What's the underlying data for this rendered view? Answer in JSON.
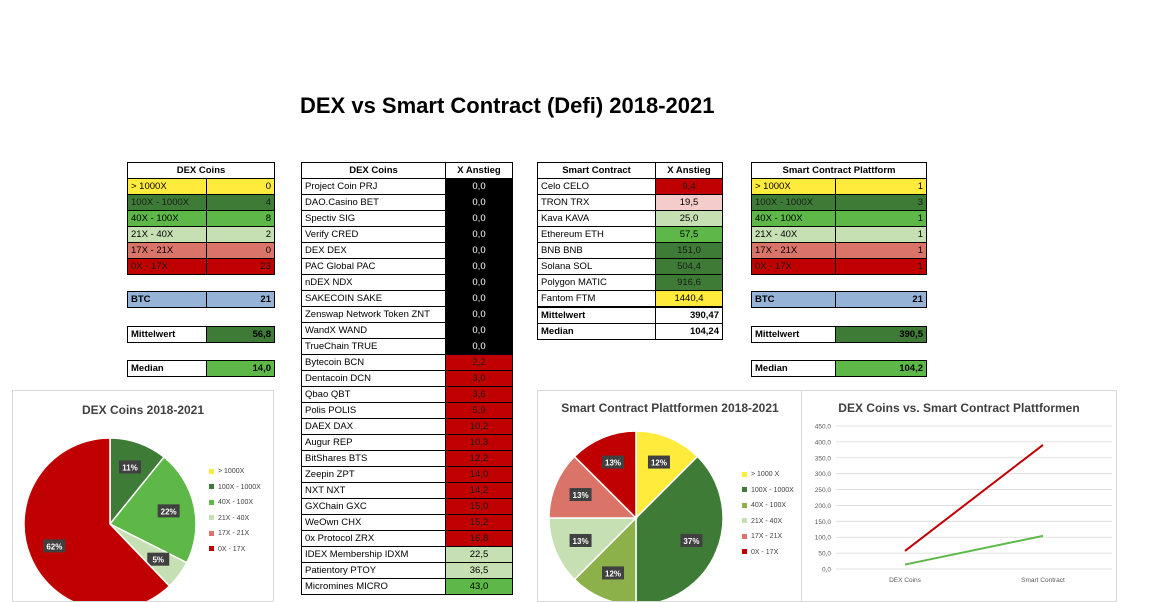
{
  "title": "DEX vs Smart Contract (Defi) 2018-2021",
  "colors": {
    "yellow": "#FFEB3B",
    "dark_green": "#3E7B36",
    "green": "#5DB847",
    "light_green": "#C6E0B4",
    "salmon": "#DA7468",
    "red": "#C00000",
    "pink": "#F4CCCC",
    "blue": "#95B3D7",
    "black": "#000000"
  },
  "dex_summary": {
    "header": "DEX Coins",
    "rows": [
      {
        "label": "> 1000X",
        "value": "0",
        "color": "#FFEB3B"
      },
      {
        "label": "100X - 1000X",
        "value": "4",
        "color": "#3E7B36"
      },
      {
        "label": "40X - 100X",
        "value": "8",
        "color": "#5DB847"
      },
      {
        "label": "21X - 40X",
        "value": "2",
        "color": "#C6E0B4"
      },
      {
        "label": "17X - 21X",
        "value": "0",
        "color": "#DA7468"
      },
      {
        "label": "0X - 17X",
        "value": "23",
        "color": "#C00000"
      }
    ],
    "btc_label": "BTC",
    "btc_value": "21",
    "mean_label": "Mittelwert",
    "mean_value": "56,8",
    "median_label": "Median",
    "median_value": "14,0"
  },
  "dex_list": {
    "col1": "DEX Coins",
    "col2": "X Anstieg",
    "rows": [
      {
        "name": "Project Coin PRJ",
        "value": "0,0",
        "color": "#000000"
      },
      {
        "name": "DAO.Casino BET",
        "value": "0,0",
        "color": "#000000"
      },
      {
        "name": "Spectiv SIG",
        "value": "0,0",
        "color": "#000000"
      },
      {
        "name": "Verify CRED",
        "value": "0,0",
        "color": "#000000"
      },
      {
        "name": "DEX DEX",
        "value": "0,0",
        "color": "#000000"
      },
      {
        "name": "PAC Global PAC",
        "value": "0,0",
        "color": "#000000"
      },
      {
        "name": "nDEX NDX",
        "value": "0,0",
        "color": "#000000"
      },
      {
        "name": "SAKECOIN SAKE",
        "value": "0,0",
        "color": "#000000"
      },
      {
        "name": "Zenswap Network Token ZNT",
        "value": "0,0",
        "color": "#000000"
      },
      {
        "name": "WandX WAND",
        "value": "0,0",
        "color": "#000000"
      },
      {
        "name": "TrueChain TRUE",
        "value": "0,0",
        "color": "#000000"
      },
      {
        "name": "Bytecoin BCN",
        "value": "2,2",
        "color": "#C00000"
      },
      {
        "name": "Dentacoin DCN",
        "value": "3,0",
        "color": "#C00000"
      },
      {
        "name": "Qbao QBT",
        "value": "3,6",
        "color": "#C00000"
      },
      {
        "name": "Polis POLIS",
        "value": "5,9",
        "color": "#C00000"
      },
      {
        "name": "DAEX DAX",
        "value": "10,2",
        "color": "#C00000"
      },
      {
        "name": "Augur REP",
        "value": "10,3",
        "color": "#C00000"
      },
      {
        "name": "BitShares BTS",
        "value": "12,2",
        "color": "#C00000"
      },
      {
        "name": "Zeepin ZPT",
        "value": "14,0",
        "color": "#C00000"
      },
      {
        "name": "NXT NXT",
        "value": "14,2",
        "color": "#C00000"
      },
      {
        "name": "GXChain GXC",
        "value": "15,0",
        "color": "#C00000"
      },
      {
        "name": "WeOwn CHX",
        "value": "15,2",
        "color": "#C00000"
      },
      {
        "name": "0x Protocol ZRX",
        "value": "16,8",
        "color": "#C00000"
      },
      {
        "name": "IDEX Membership IDXM",
        "value": "22,5",
        "color": "#C6E0B4"
      },
      {
        "name": "Patientory PTOY",
        "value": "36,5",
        "color": "#C6E0B4"
      },
      {
        "name": "Micromines MICRO",
        "value": "43,0",
        "color": "#5DB847"
      }
    ]
  },
  "sc_list": {
    "col1": "Smart Contract",
    "col2": "X Anstieg",
    "rows": [
      {
        "name": "Celo CELO",
        "value": "9,4",
        "color": "#C00000"
      },
      {
        "name": "TRON TRX",
        "value": "19,5",
        "color": "#F4CCCC"
      },
      {
        "name": "Kava KAVA",
        "value": "25,0",
        "color": "#C6E0B4"
      },
      {
        "name": "Ethereum ETH",
        "value": "57,5",
        "color": "#5DB847"
      },
      {
        "name": "BNB BNB",
        "value": "151,0",
        "color": "#3E7B36"
      },
      {
        "name": "Solana SOL",
        "value": "504,4",
        "color": "#3E7B36"
      },
      {
        "name": "Polygon MATIC",
        "value": "916,6",
        "color": "#3E7B36"
      },
      {
        "name": "Fantom FTM",
        "value": "1440,4",
        "color": "#FFEB3B"
      }
    ],
    "mean_label": "Mittelwert",
    "mean_value": "390,47",
    "median_label": "Median",
    "median_value": "104,24"
  },
  "sc_summary": {
    "header": "Smart Contract Plattform",
    "rows": [
      {
        "label": "> 1000X",
        "value": "1",
        "color": "#FFEB3B"
      },
      {
        "label": "100X - 1000X",
        "value": "3",
        "color": "#3E7B36"
      },
      {
        "label": "40X - 100X",
        "value": "1",
        "color": "#5DB847"
      },
      {
        "label": "21X - 40X",
        "value": "1",
        "color": "#C6E0B4"
      },
      {
        "label": "17X - 21X",
        "value": "1",
        "color": "#DA7468"
      },
      {
        "label": "0X - 17X",
        "value": "1",
        "color": "#C00000"
      }
    ],
    "btc_label": "BTC",
    "btc_value": "21",
    "mean_label": "Mittelwert",
    "mean_value": "390,5",
    "median_label": "Median",
    "median_value": "104,2"
  },
  "chart_data": [
    {
      "type": "pie",
      "title": "DEX Coins 2018-2021",
      "labels": [
        "> 1000X",
        "100X - 1000X",
        "40X - 100X",
        "21X - 40X",
        "17X - 21X",
        "0X - 17X"
      ],
      "values": [
        0,
        4,
        8,
        2,
        0,
        23
      ],
      "data_labels": [
        "",
        "11%",
        "22%",
        "5%",
        "",
        "62%"
      ],
      "colors": [
        "#FFEB3B",
        "#3E7B36",
        "#5DB847",
        "#C6E0B4",
        "#DA7468",
        "#C00000"
      ],
      "legend": "right"
    },
    {
      "type": "pie",
      "title": "Smart Contract Plattformen 2018-2021",
      "labels": [
        "> 1000 X",
        "100X - 1000X",
        "40X - 100X",
        "21X - 40X",
        "17X - 21X",
        "0X - 17X"
      ],
      "values": [
        1,
        3,
        1,
        1,
        1,
        1
      ],
      "data_labels": [
        "12%",
        "37%",
        "12%",
        "13%",
        "13%",
        "13%"
      ],
      "colors": [
        "#FFEB3B",
        "#3E7B36",
        "#8DB14A",
        "#C6E0B4",
        "#DA7468",
        "#C00000"
      ],
      "legend": "right"
    },
    {
      "type": "line",
      "title": "DEX Coins vs. Smart Contract Plattformen",
      "categories": [
        "DEX Coins",
        "Smart Contract"
      ],
      "series": [
        {
          "values": [
            56.8,
            390.5
          ],
          "color": "#C00000"
        },
        {
          "values": [
            14.0,
            104.2
          ],
          "color": "#5DB847"
        }
      ],
      "ylim": [
        0,
        450
      ],
      "yticks": [
        "0,0",
        "50,0",
        "100,0",
        "150,0",
        "200,0",
        "250,0",
        "300,0",
        "350,0",
        "400,0",
        "450,0"
      ],
      "grid": true
    }
  ]
}
